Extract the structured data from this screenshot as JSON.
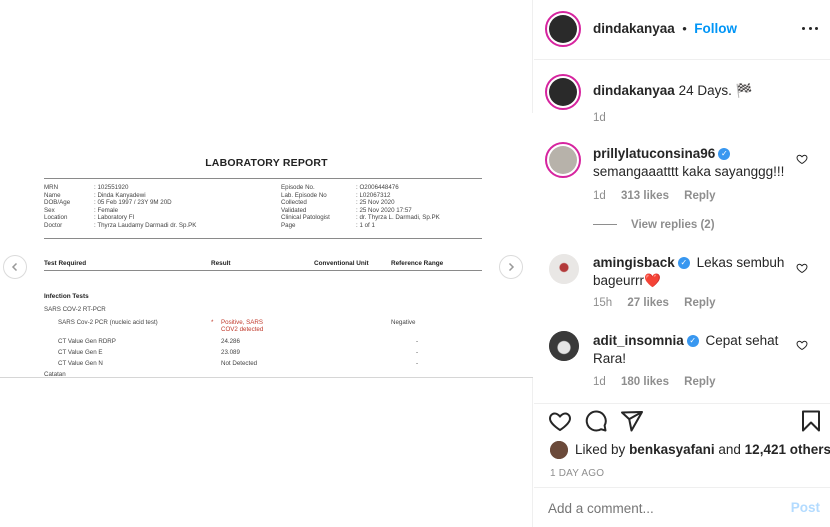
{
  "report": {
    "title": "LABORATORY REPORT",
    "left_fields": [
      {
        "label": "MRN",
        "value": ": 102551920"
      },
      {
        "label": "Name",
        "value": ": Dinda Kanyadewi"
      },
      {
        "label": "DOB/Age",
        "value": ": 05 Feb 1997    / 23Y 9M 20D"
      },
      {
        "label": "Sex",
        "value": ": Female"
      },
      {
        "label": "Location",
        "value": ": Laboratory FI"
      },
      {
        "label": "Doctor",
        "value": ": Thyrza Laudamy Darmadi dr. Sp.PK"
      }
    ],
    "right_fields": [
      {
        "label": "Episode No.",
        "value": ": O2006448476"
      },
      {
        "label": "Lab. Episode No",
        "value": ": L02067312"
      },
      {
        "label": "Collected",
        "value": ": 25 Nov 2020"
      },
      {
        "label": "Validated",
        "value": ": 25 Nov 2020    17:57"
      },
      {
        "label": "Clinical Patologist",
        "value": ": dr. Thyrza L. Darmadi, Sp.PK"
      },
      {
        "label": "Page",
        "value": ": 1 of 1"
      }
    ],
    "col_test": "Test Required",
    "col_result": "Result",
    "col_unit": "Conventional Unit",
    "col_ref": "Reference Range",
    "section": "Infection Tests",
    "subsection": "SARS COV-2 RT-PCR",
    "rows": [
      {
        "test": "SARS Cov-2 PCR (nucleic acid test)",
        "flag": "*",
        "result": "Positive, SARS",
        "result2": "COV2 detected",
        "ref": "Negative"
      },
      {
        "test": "CT Value Gen RDRP",
        "flag": "",
        "result": "24.286",
        "result2": "",
        "ref": "-"
      },
      {
        "test": "CT Value Gen E",
        "flag": "",
        "result": "23.089",
        "result2": "",
        "ref": "-"
      },
      {
        "test": "CT Value Gen N",
        "flag": "",
        "result": "Not Detected",
        "result2": "",
        "ref": "-"
      },
      {
        "test": "Catatan",
        "flag": "",
        "result": "",
        "result2": "",
        "ref": ""
      }
    ]
  },
  "header": {
    "username": "dindakanyaa",
    "separator": "•",
    "follow_label": "Follow"
  },
  "caption": {
    "username": "dindakanyaa",
    "text": "24 Days. 🏁",
    "time": "1d"
  },
  "comments": [
    {
      "username": "prillylatuconsina96",
      "text": "semangaaatttt kaka sayanggg!!!",
      "time": "1d",
      "likes": "313 likes",
      "reply": "Reply",
      "view_replies": "View replies (2)"
    },
    {
      "username": "amingisback",
      "text": "Lekas sembuh bageurrr",
      "emoji": "❤️",
      "time": "15h",
      "likes": "27 likes",
      "reply": "Reply"
    },
    {
      "username": "adit_insomnia",
      "text": "Cepat sehat Rara!",
      "time": "1d",
      "likes": "180 likes",
      "reply": "Reply"
    }
  ],
  "likes_line": {
    "prefix": "Liked by",
    "user": "benkasyafani",
    "and": "and",
    "others": "12,421 others"
  },
  "post_time": "1 DAY AGO",
  "add_comment": {
    "placeholder": "Add a comment...",
    "post_label": "Post"
  },
  "icons": {
    "heart": "heart-icon",
    "comment": "comment-icon",
    "share": "share-icon",
    "bookmark": "bookmark-icon",
    "more": "more-icon",
    "prev": "chevron-left-icon",
    "next": "chevron-right-icon"
  },
  "colors": {
    "accent": "#0095f6",
    "verified": "#3897f0",
    "meta": "#8e8e8e",
    "heart_emoji": "#ed4956"
  }
}
